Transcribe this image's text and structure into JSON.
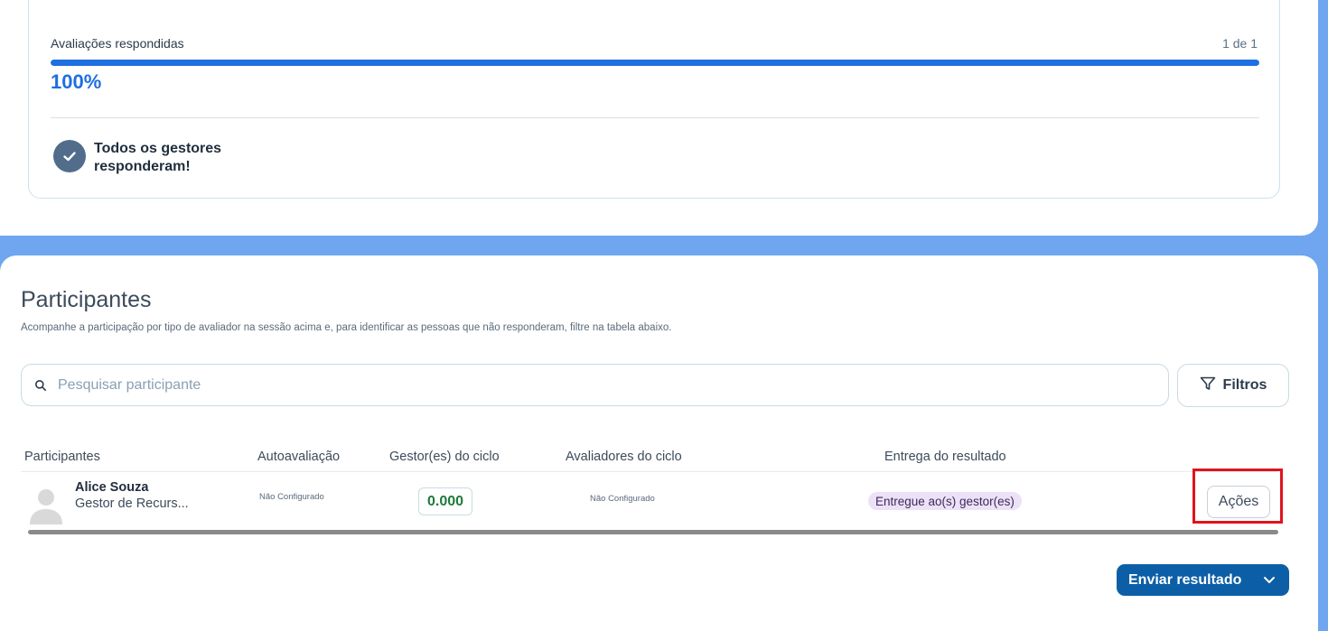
{
  "progress_card": {
    "title": "Avaliações respondidas",
    "count": "1 de 1",
    "progress_fraction": 1.0,
    "percent_label": "100%",
    "completion_message": "Todos os gestores responderam!"
  },
  "participants": {
    "title": "Participantes",
    "description": "Acompanhe a participação por tipo de avaliador na sessão acima e, para identificar as pessoas que não responderam, filtre na tabela abaixo.",
    "search": {
      "placeholder": "Pesquisar participante",
      "value": ""
    },
    "filter_label": "Filtros",
    "table": {
      "headers": [
        "Participantes",
        "Autoavaliação",
        "Gestor(es) do ciclo",
        "Avaliadores do ciclo",
        "Entrega do resultado"
      ],
      "rows": [
        {
          "name": "Alice Souza",
          "role": "Gestor de Recurs...",
          "self_eval": "Não Configurado",
          "manager_score": "0.000",
          "cycle_evaluators": "Não Configurado",
          "delivery": "Entregue ao(s) gestor(es)",
          "actions_label": "Ações"
        }
      ]
    },
    "send_button": "Enviar resultado"
  },
  "colors": {
    "accent": "#1e6fe0",
    "primary_button": "#0c5fa6",
    "highlight": "#e0131d",
    "badge_bg": "#ece1f7"
  },
  "icons": [
    "check-icon",
    "search-icon",
    "filter-icon",
    "avatar-icon",
    "chevron-down-icon"
  ]
}
